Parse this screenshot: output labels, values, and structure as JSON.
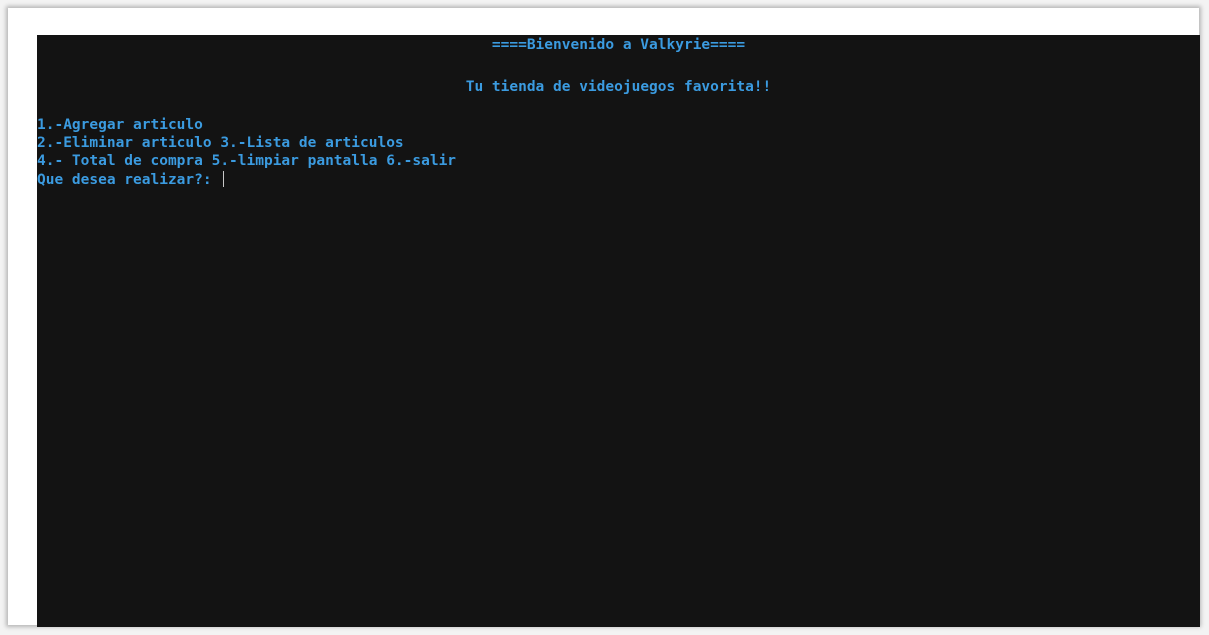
{
  "console": {
    "banner": "====Bienvenido a Valkyrie====",
    "tagline": "Tu tienda de videojuegos favorita!!",
    "menu_lines": [
      "1.-Agregar articulo",
      "2.-Eliminar articulo 3.-Lista de articulos",
      "4.- Total de compra 5.-limpiar pantalla 6.-salir"
    ],
    "prompt": "Que desea realizar?: ",
    "input_value": ""
  },
  "colors": {
    "background": "#131313",
    "text": "#3b9be0",
    "cursor": "#c8c8c8"
  }
}
